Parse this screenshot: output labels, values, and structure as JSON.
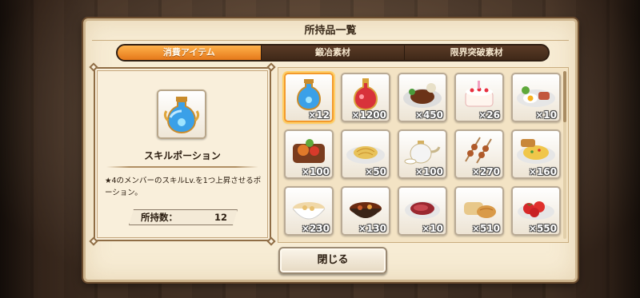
{
  "dialog": {
    "title": "所持品一覧",
    "close_label": "閉じる"
  },
  "tabs": [
    {
      "label": "消費アイテム",
      "active": true
    },
    {
      "label": "鍛冶素材",
      "active": false
    },
    {
      "label": "限界突破素材",
      "active": false
    }
  ],
  "detail": {
    "icon": "skill-potion-icon",
    "name": "スキルポーション",
    "description": "★4のメンバーのスキルLv.を1つ上昇させるポーション。",
    "quantity_label": "所持数：",
    "quantity_value": "12"
  },
  "inventory": [
    {
      "icon": "skill-potion-icon",
      "count": "×12",
      "selected": true
    },
    {
      "icon": "red-potion-icon",
      "count": "×1200"
    },
    {
      "icon": "steak-plate-icon",
      "count": "×450"
    },
    {
      "icon": "birthday-cake-icon",
      "count": "×26"
    },
    {
      "icon": "bacon-eggs-icon",
      "count": "×10"
    },
    {
      "icon": "bento-meal-icon",
      "count": "×100"
    },
    {
      "icon": "pasta-plate-icon",
      "count": "×50"
    },
    {
      "icon": "teapot-icon",
      "count": "×100"
    },
    {
      "icon": "skewers-icon",
      "count": "×270"
    },
    {
      "icon": "fried-rice-icon",
      "count": "×160"
    },
    {
      "icon": "soup-bowl-icon",
      "count": "×230"
    },
    {
      "icon": "stew-pot-icon",
      "count": "×130"
    },
    {
      "icon": "ham-icon",
      "count": "×10"
    },
    {
      "icon": "bread-icon",
      "count": "×510"
    },
    {
      "icon": "tomatoes-icon",
      "count": "×550"
    }
  ],
  "colors": {
    "tab_active": "#f08a25",
    "tab_inactive": "#4a3120",
    "panel_bg": "#f7ecd4",
    "selection": "#f39a2b"
  }
}
